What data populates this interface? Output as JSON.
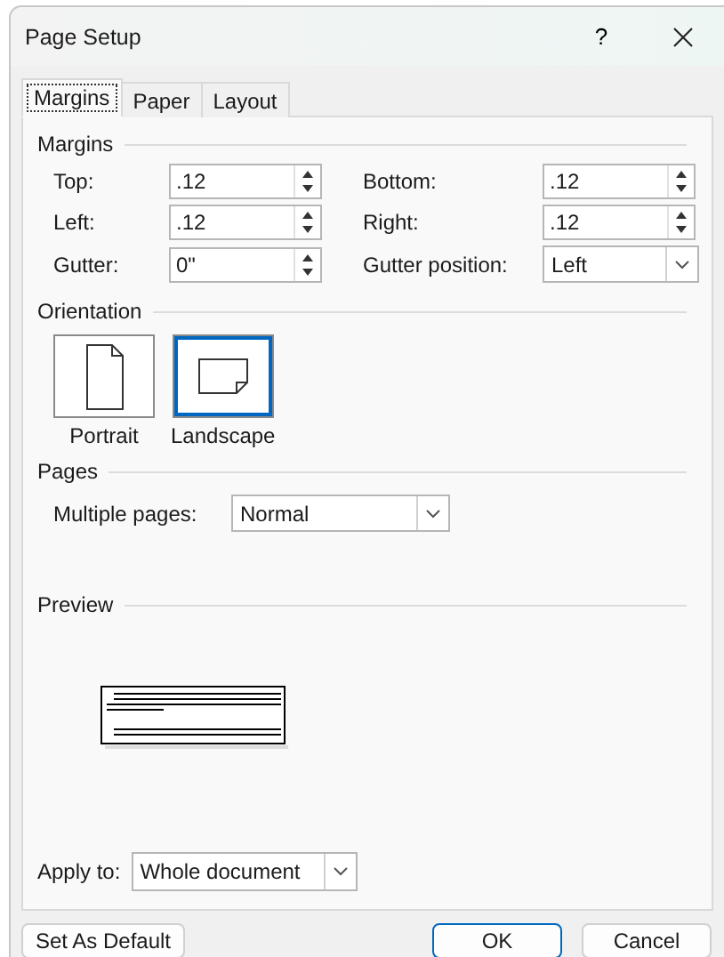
{
  "window": {
    "title": "Page Setup",
    "help_button": "?"
  },
  "tabs": [
    {
      "label": "Margins",
      "selected": true
    },
    {
      "label": "Paper",
      "selected": false
    },
    {
      "label": "Layout",
      "selected": false
    }
  ],
  "margins": {
    "heading": "Margins",
    "rows": [
      {
        "left": {
          "label": "Top:",
          "value": ".12",
          "kind": "spin"
        },
        "right": {
          "label": "Bottom:",
          "value": ".12",
          "kind": "spin"
        }
      },
      {
        "left": {
          "label": "Left:",
          "value": ".12",
          "kind": "spin"
        },
        "right": {
          "label": "Right:",
          "value": ".12",
          "kind": "spin"
        }
      },
      {
        "left": {
          "label": "Gutter:",
          "value": "0\"",
          "kind": "spin"
        },
        "right": {
          "label": "Gutter position:",
          "value": "Left",
          "kind": "select"
        }
      }
    ]
  },
  "orientation": {
    "heading": "Orientation",
    "options": [
      {
        "label": "Portrait",
        "kind": "portrait",
        "selected": false
      },
      {
        "label": "Landscape",
        "kind": "landscape",
        "selected": true
      }
    ]
  },
  "pages": {
    "heading": "Pages",
    "multiple_pages": {
      "label": "Multiple pages:",
      "value": "Normal"
    }
  },
  "preview": {
    "heading": "Preview"
  },
  "apply_to": {
    "label": "Apply to:",
    "value": "Whole document"
  },
  "buttons": [
    {
      "label": "Set As Default",
      "kind": "left"
    },
    {
      "label": "OK",
      "kind": "default"
    },
    {
      "label": "Cancel",
      "kind": "normal"
    }
  ]
}
